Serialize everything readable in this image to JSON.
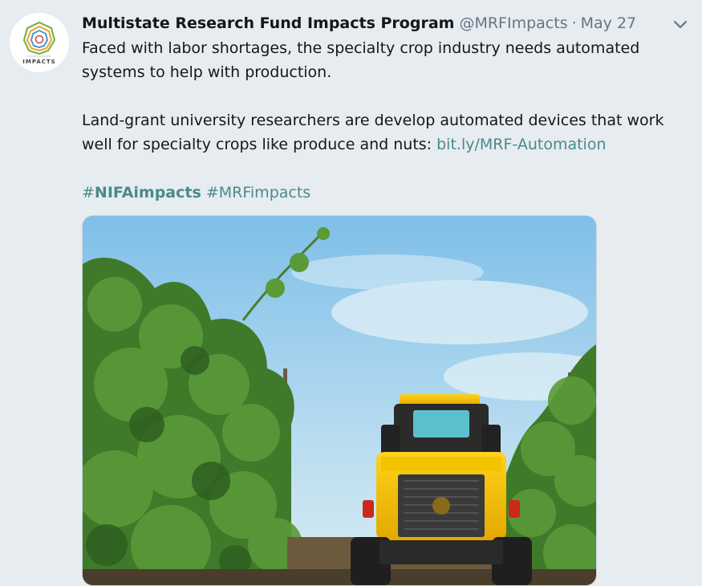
{
  "tweet": {
    "author_name": "Multistate Research Fund Impacts Program",
    "handle": "@MRFImpacts",
    "separator": "·",
    "date": "May 27",
    "avatar_text": "IMPACTS",
    "paragraph1": "Faced with labor shortages, the specialty crop industry needs automated systems to help with production.",
    "paragraph2_text": "Land-grant university researchers are develop automated devices that work well for specialty crops like produce and nuts: ",
    "paragraph2_link": "bit.ly/MRF-Automation",
    "hashtag1_hash": "#",
    "hashtag1_word": "NIFAimpacts",
    "hashtag2": "#MRFimpacts"
  },
  "icons": {
    "menu": "chevron-down-icon"
  },
  "colors": {
    "background": "#e6ecf0",
    "link": "#4a8a8c",
    "secondary_text": "#657786",
    "primary_text": "#14171a"
  }
}
